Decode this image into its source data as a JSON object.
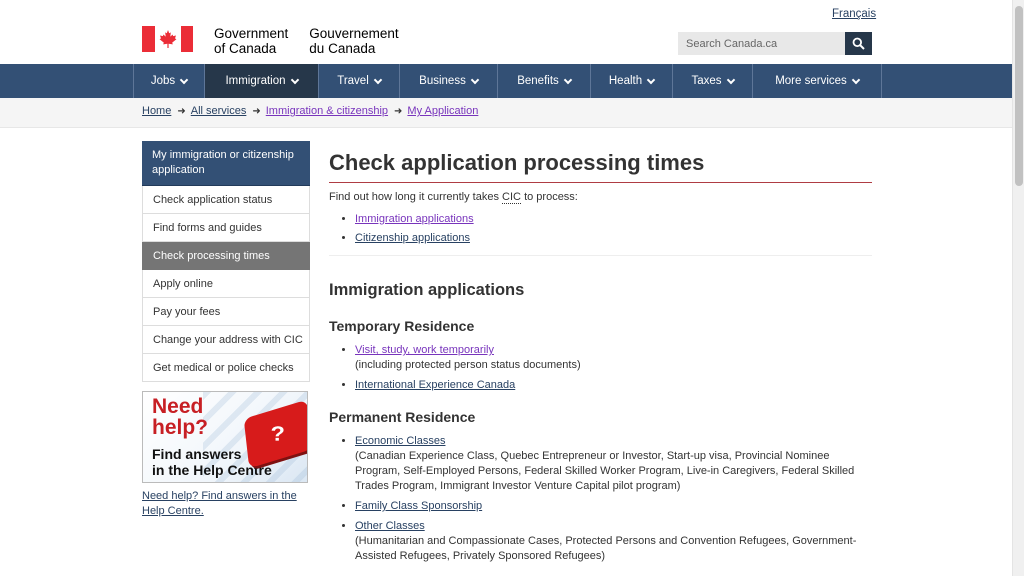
{
  "header": {
    "language_link": "Français",
    "gov_en": [
      "Government",
      "of Canada"
    ],
    "gov_fr": [
      "Gouvernement",
      "du Canada"
    ],
    "search_placeholder": "Search Canada.ca"
  },
  "nav": {
    "items": [
      {
        "label": "Jobs"
      },
      {
        "label": "Immigration"
      },
      {
        "label": "Travel"
      },
      {
        "label": "Business"
      },
      {
        "label": "Benefits"
      },
      {
        "label": "Health"
      },
      {
        "label": "Taxes"
      },
      {
        "label": "More services"
      }
    ],
    "active": "Immigration"
  },
  "breadcrumb": [
    "Home",
    "All services",
    "Immigration & citizenship",
    "My Application"
  ],
  "sidebar": {
    "heading": "My immigration or citizenship application",
    "items": [
      {
        "label": "Check application status"
      },
      {
        "label": "Find forms and guides"
      },
      {
        "label": "Check processing times"
      },
      {
        "label": "Apply online"
      },
      {
        "label": "Pay your fees"
      },
      {
        "label": "Change your address with CIC"
      },
      {
        "label": "Get medical or police checks"
      }
    ],
    "active": "Check processing times",
    "help_image": {
      "line1": "Need",
      "line2": "help?",
      "line3": "Find answers",
      "line4": "in the Help Centre",
      "key": "?"
    },
    "help_link": "Need help? Find answers in the Help Centre."
  },
  "main": {
    "title": "Check application processing times",
    "intro_prefix": "Find out how long it currently takes",
    "intro_abbr": "CIC",
    "intro_suffix": "to process:",
    "toc": [
      "Immigration applications",
      "Citizenship applications"
    ],
    "section_title": "Immigration applications",
    "temporary": {
      "title": "Temporary Residence",
      "items": [
        {
          "label": "Visit, study, work temporarily",
          "desc": "(including protected person status documents)"
        },
        {
          "label": "International Experience Canada",
          "desc": ""
        }
      ]
    },
    "permanent": {
      "title": "Permanent Residence",
      "items": [
        {
          "label": "Economic Classes",
          "desc": "(Canadian Experience Class, Quebec Entrepreneur or Investor, Start-up visa, Provincial Nominee Program, Self-Employed Persons, Federal Skilled Worker Program, Live-in Caregivers, Federal Skilled Trades Program, Immigrant Investor Venture Capital pilot program)"
        },
        {
          "label": "Family Class Sponsorship",
          "desc": ""
        },
        {
          "label": "Other Classes",
          "desc": "(Humanitarian and Compassionate Cases, Protected Persons and Convention Refugees, Government-Assisted Refugees, Privately Sponsored Refugees)"
        }
      ]
    }
  },
  "colors": {
    "nav_bg": "#335075",
    "nav_active": "#26374a",
    "flag_red": "#eb2d37",
    "title_rule": "#af3c43",
    "link": "#284162",
    "visited_link": "#7834bc"
  }
}
